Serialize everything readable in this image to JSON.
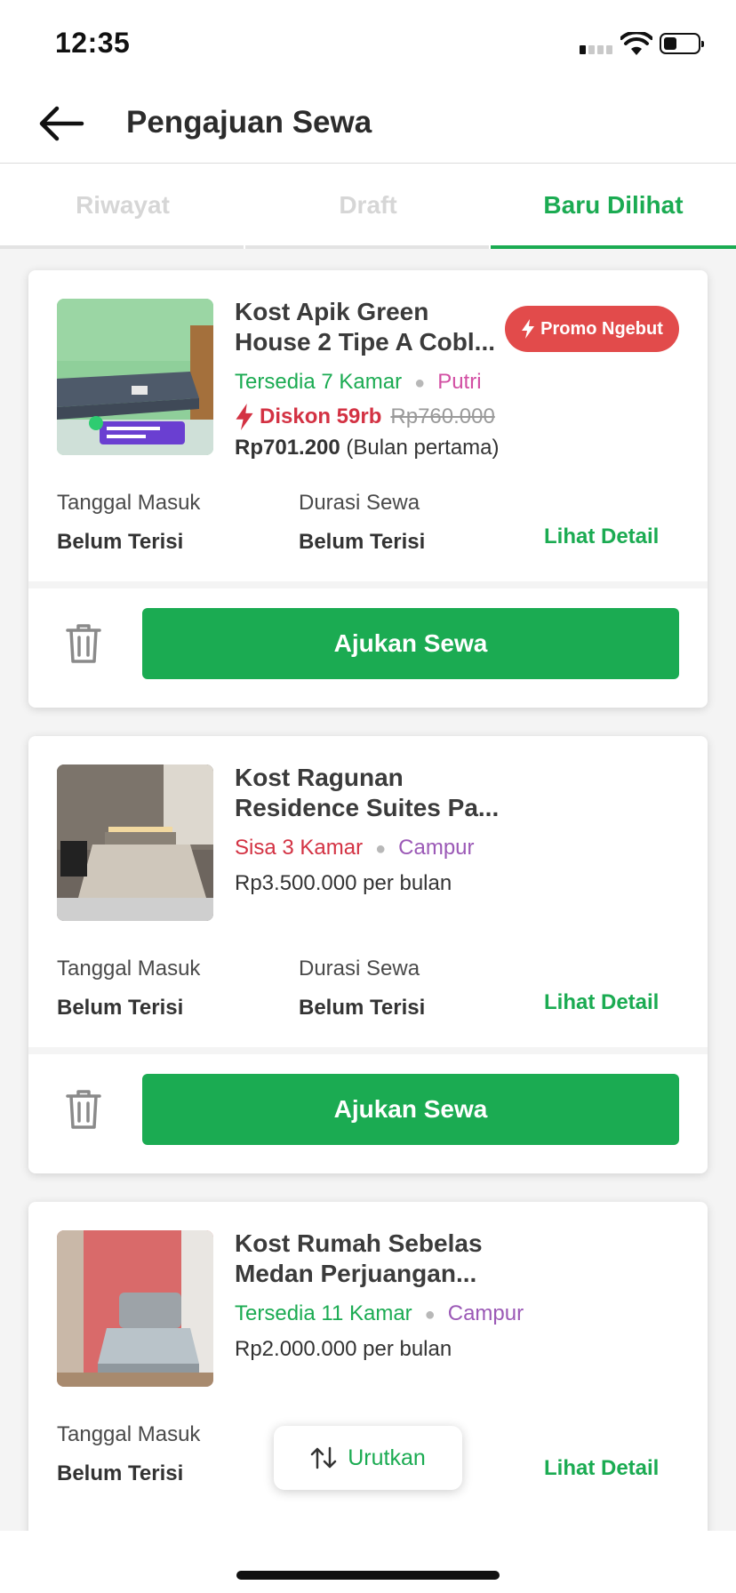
{
  "status_bar": {
    "time": "12:35"
  },
  "header": {
    "title": "Pengajuan Sewa"
  },
  "tabs": [
    {
      "label": "Riwayat",
      "active": false
    },
    {
      "label": "Draft",
      "active": false
    },
    {
      "label": "Baru Dilihat",
      "active": true
    }
  ],
  "colors": {
    "accent": "#1bab52",
    "danger": "#d33243",
    "promo": "#e24b4b",
    "gender": "#9b59b6"
  },
  "cards": [
    {
      "name_line1": "Kost Apik Green",
      "name_line2": "House 2 Tipe A Cobl...",
      "availability": "Tersedia 7 Kamar",
      "gender": "Putri",
      "promo_badge": "Promo Ngebut",
      "discount_label": "Diskon 59rb",
      "original_price": "Rp760.000",
      "final_price": "Rp701.200",
      "final_price_note": "(Bulan pertama)",
      "thumbnail_icon": "room-photo",
      "tanggal_label": "Tanggal Masuk",
      "tanggal_value": "Belum Terisi",
      "durasi_label": "Durasi Sewa",
      "durasi_value": "Belum Terisi",
      "detail_link": "Lihat Detail",
      "apply_button": "Ajukan Sewa"
    },
    {
      "name_line1": "Kost Ragunan",
      "name_line2": "Residence Suites Pa...",
      "availability": "Sisa 3 Kamar",
      "gender": "Campur",
      "price": "Rp3.500.000 per bulan",
      "thumbnail_icon": "room-photo",
      "tanggal_label": "Tanggal Masuk",
      "tanggal_value": "Belum Terisi",
      "durasi_label": "Durasi Sewa",
      "durasi_value": "Belum Terisi",
      "detail_link": "Lihat Detail",
      "apply_button": "Ajukan Sewa"
    },
    {
      "name_line1": "Kost Rumah Sebelas",
      "name_line2": "Medan Perjuangan...",
      "availability": "Tersedia 11 Kamar",
      "gender": "Campur",
      "price": "Rp2.000.000 per bulan",
      "thumbnail_icon": "room-photo",
      "tanggal_label": "Tanggal Masuk",
      "tanggal_value": "Belum Terisi",
      "detail_link": "Lihat Detail"
    }
  ],
  "sort_button": {
    "label": "Urutkan",
    "icon": "sort-arrows-icon"
  }
}
